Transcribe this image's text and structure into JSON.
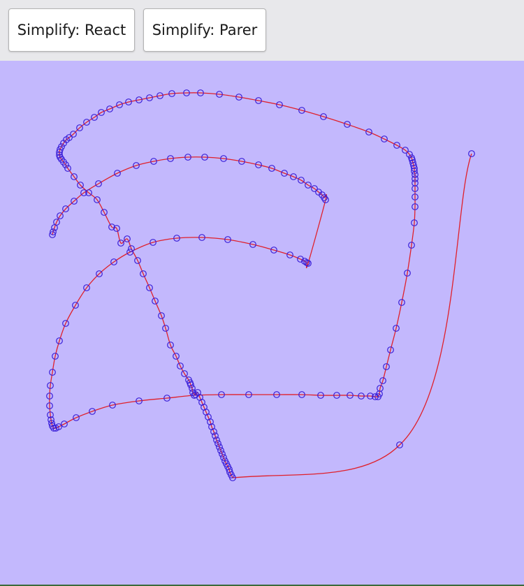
{
  "toolbar": {
    "react_label": "Simplify: React",
    "parer_label": "Simplify: Parer"
  },
  "colors": {
    "toolbar_bg": "#e8e8eb",
    "canvas_bg": "#c3b8fd",
    "curve": "#e0202a",
    "points": "#3a1fd8"
  }
}
